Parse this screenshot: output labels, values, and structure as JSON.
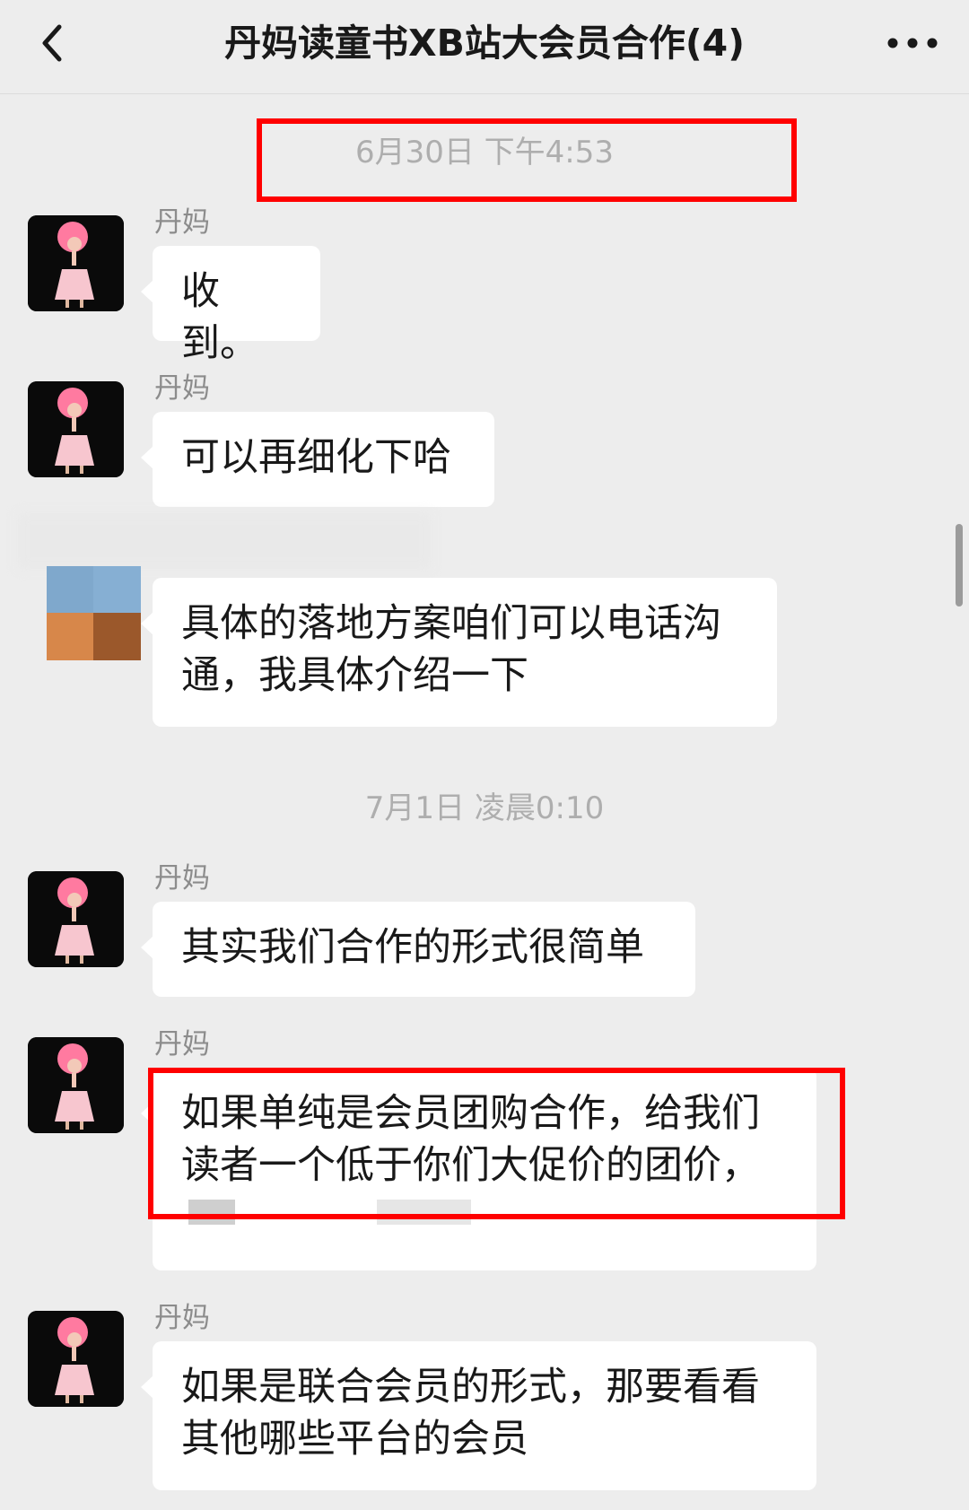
{
  "header": {
    "title": "丹妈读童书XB站大会员合作(4)",
    "back_icon": "chevron-left-icon",
    "more_icon": "more-dots-icon"
  },
  "timestamps": {
    "first": "6月30日 下午4:53",
    "second": "7月1日 凌晨0:10"
  },
  "messages": [
    {
      "sender": "丹妈",
      "lines": [
        "收到。"
      ]
    },
    {
      "sender": "丹妈",
      "lines": [
        "可以再细化下哈"
      ]
    },
    {
      "sender": "",
      "lines": [
        "具体的落地方案咱们可以电话沟",
        "通，我具体介绍一下"
      ]
    },
    {
      "sender": "丹妈",
      "lines": [
        "其实我们合作的形式很简单"
      ]
    },
    {
      "sender": "丹妈",
      "lines": [
        "如果单纯是会员团购合作，给我们",
        "读者一个低于你们大促价的团价，"
      ]
    },
    {
      "sender": "丹妈",
      "lines": [
        "如果是联合会员的形式，那要看看",
        "其他哪些平台的会员"
      ]
    }
  ],
  "colors": {
    "highlight": "#ff0000",
    "bubble": "#ffffff",
    "background": "#ededed"
  }
}
